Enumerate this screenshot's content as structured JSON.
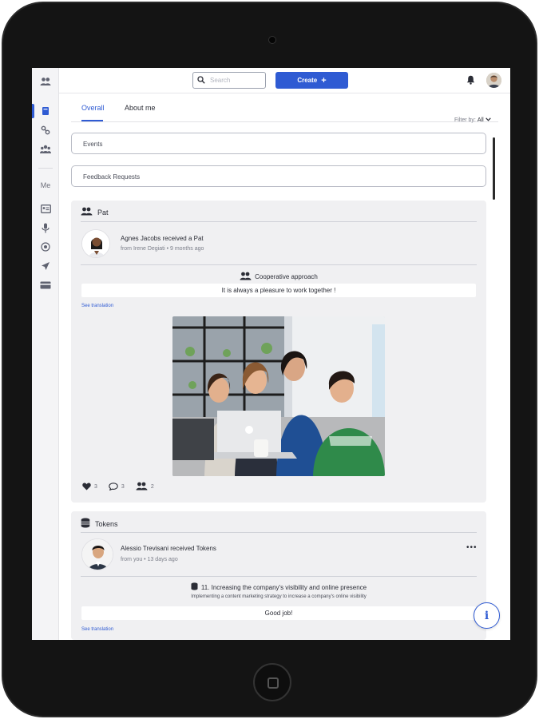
{
  "topbar": {
    "search_placeholder": "Search",
    "create_label": "Create",
    "create_icon": "plus-icon"
  },
  "sidebar": {
    "section_label": "Me",
    "icons": [
      "people-icon",
      "book-icon",
      "link-icon",
      "group-icon",
      "id-card-icon",
      "microphone-icon",
      "target-icon",
      "rocket-icon",
      "card-icon"
    ]
  },
  "tabs": [
    {
      "label": "Overall",
      "active": true
    },
    {
      "label": "About me",
      "active": false
    }
  ],
  "filter": {
    "label": "Filter by:",
    "value": "All"
  },
  "sections": {
    "events": "Events",
    "feedback_requests": "Feedback Requests"
  },
  "pat_card": {
    "heading": "Pat",
    "title": "Agnes Jacobs received a Pat",
    "meta": "from Irene Degiati  • 9 months ago",
    "value_name": "Cooperative approach",
    "message": "It is always a pleasure to work together !",
    "see_translation": "See translation",
    "likes": "3",
    "comments": "3",
    "pats": "2"
  },
  "tokens_card": {
    "heading": "Tokens",
    "title": "Alessio Trevisani received Tokens",
    "meta": "from you  • 13 days ago",
    "more": "•••",
    "goal_title": "11. Increasing the company's visibility and online presence",
    "goal_subtitle": "Implementing a content marketing strategy to increase a company's online visibility",
    "message": "Good job!",
    "see_translation": "See translation"
  },
  "colors": {
    "accent": "#2f5bd3",
    "card_bg": "#f0f0f2",
    "text": "#2b2d36"
  }
}
